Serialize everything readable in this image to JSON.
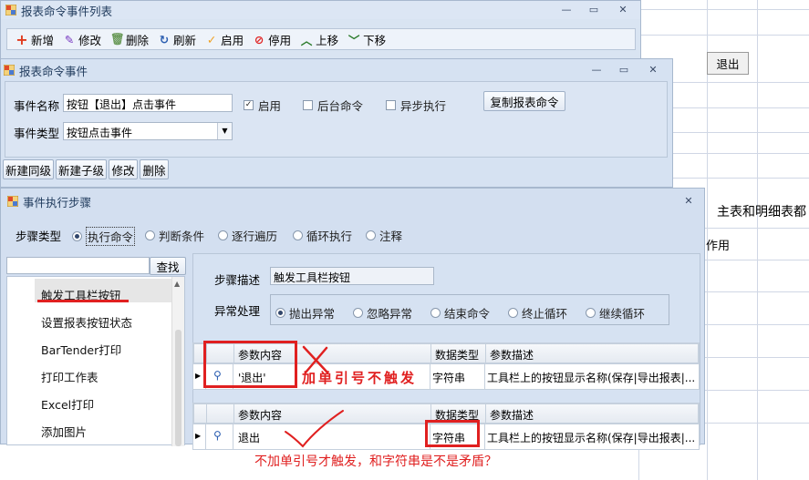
{
  "bg": {
    "exit_button": "退出",
    "text_main_detail": "主表和明细表都",
    "text_effect": "作用"
  },
  "win1": {
    "title": "报表命令事件列表",
    "toolbar": [
      {
        "label": "新增",
        "icon": "plus-icon"
      },
      {
        "label": "修改",
        "icon": "pencil-icon"
      },
      {
        "label": "删除",
        "icon": "trash-icon"
      },
      {
        "label": "刷新",
        "icon": "refresh-icon"
      },
      {
        "label": "启用",
        "icon": "check-icon"
      },
      {
        "label": "停用",
        "icon": "stop-icon"
      },
      {
        "label": "上移",
        "icon": "chevron-up-icon"
      },
      {
        "label": "下移",
        "icon": "chevron-down-icon"
      }
    ]
  },
  "win2": {
    "title": "报表命令事件",
    "event_name_label": "事件名称",
    "event_name_value": "按钮【退出】点击事件",
    "enabled_label": "启用",
    "background_label": "后台命令",
    "async_label": "异步执行",
    "copy_button": "复制报表命令",
    "event_type_label": "事件类型",
    "event_type_value": "按钮点击事件",
    "actions": [
      "新建同级",
      "新建子级",
      "修改",
      "删除"
    ]
  },
  "win3": {
    "title": "事件执行步骤",
    "step_type_label": "步骤类型",
    "step_types": [
      "执行命令",
      "判断条件",
      "逐行遍历",
      "循环执行",
      "注释"
    ],
    "search_button": "查找",
    "list_items": [
      "触发工具栏按钮",
      "设置报表按钮状态",
      "BarTender打印",
      "打印工作表",
      "Excel打印",
      "添加图片"
    ],
    "step_desc_label": "步骤描述",
    "step_desc_value": "触发工具栏按钮",
    "exception_label": "异常处理",
    "exception_options": [
      "抛出异常",
      "忽略异常",
      "结束命令",
      "终止循环",
      "继续循环"
    ],
    "grid_headers": [
      "参数内容",
      "数据类型",
      "参数描述"
    ],
    "grid1_row": [
      "'退出'",
      "字符串",
      "工具栏上的按钮显示名称(保存|导出报表|..."
    ],
    "grid2_row": [
      "退出",
      "字符串",
      "工具栏上的按钮显示名称(保存|导出报表|..."
    ]
  },
  "annotations": {
    "note_quoted": "加单引号不触发",
    "note_bottom": "不加单引号才触发，和字符串是不是矛盾？",
    "red": "#e02020"
  }
}
